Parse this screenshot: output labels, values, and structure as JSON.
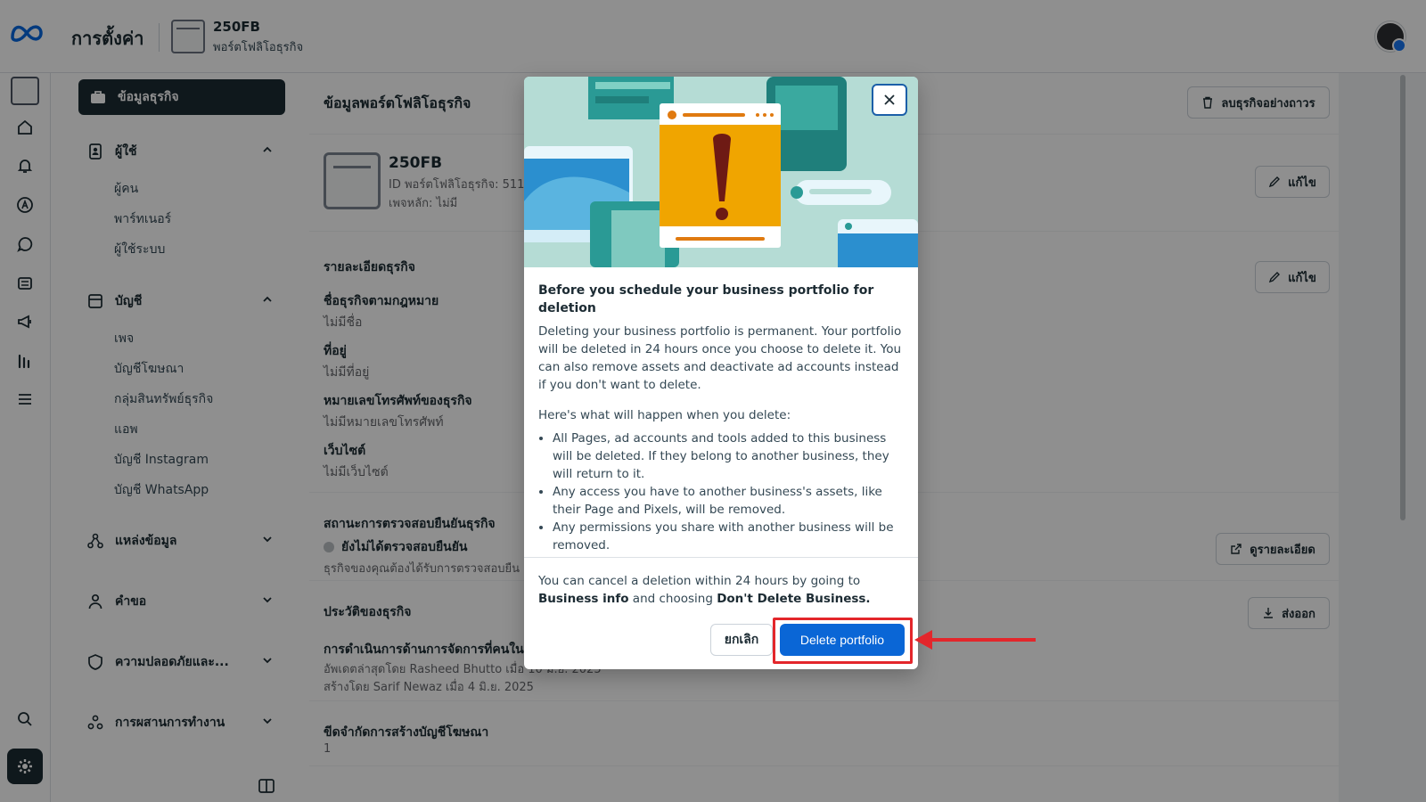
{
  "header": {
    "title": "การตั้งค่า",
    "portfolio_name": "250FB",
    "portfolio_sub": "พอร์ตโฟลิโอธุรกิจ"
  },
  "nav": {
    "active": "ข้อมูลธุรกิจ",
    "groups": [
      {
        "label": "ผู้ใช้",
        "items": [
          "ผู้คน",
          "พาร์ทเนอร์",
          "ผู้ใช้ระบบ"
        ]
      },
      {
        "label": "บัญชี",
        "items": [
          "เพจ",
          "บัญชีโฆษณา",
          "กลุ่มสินทรัพย์ธุรกิจ",
          "แอพ",
          "บัญชี Instagram",
          "บัญชี WhatsApp"
        ]
      },
      {
        "label": "แหล่งข้อมูล",
        "items": []
      },
      {
        "label": "คำขอ",
        "items": []
      },
      {
        "label": "ความปลอดภัยและ...",
        "items": []
      },
      {
        "label": "การผสานการทำงาน",
        "items": []
      }
    ]
  },
  "main": {
    "section_title": "ข้อมูลพอร์ตโฟลิโอธุรกิจ",
    "delete_permanent": "ลบธุรกิจอย่างถาวร",
    "edit_label": "แก้ไข",
    "biz_name": "250FB",
    "biz_id": "ID พอร์ตโฟลิโอธุรกิจ: 511",
    "main_page": "เพจหลัก: ไม่มี",
    "details_title": "รายละเอียดธุรกิจ",
    "legal_name_label": "ชื่อธุรกิจตามกฎหมาย",
    "legal_name_value": "ไม่มีชื่อ",
    "address_label": "ที่อยู่",
    "address_value": "ไม่มีที่อยู่",
    "phone_label": "หมายเลขโทรศัพท์ของธุรกิจ",
    "phone_value": "ไม่มีหมายเลขโทรศัพท์",
    "website_label": "เว็บไซต์",
    "website_value": "ไม่มีเว็บไซต์",
    "verify_title": "สถานะการตรวจสอบยืนยันธุรกิจ",
    "verify_status": "ยังไม่ได้ตรวจสอบยืนยัน",
    "verify_desc": "ธุรกิจของคุณต้องได้รับการตรวจสอบยืน",
    "view_details": "ดูรายละเอียด",
    "history_title": "ประวัติของธุรกิจ",
    "export_label": "ส่งออก",
    "history_item": "การดำเนินการด้านการจัดการที่คนใน",
    "history_updated": "อัพเดตล่าสุดโดย Rasheed Bhutto เมื่อ 10 มิ.ย. 2025",
    "history_created": "สร้างโดย Sarif Newaz เมื่อ 4 มิ.ย. 2025",
    "ad_limit_title": "ขีดจำกัดการสร้างบัญชีโฆษณา",
    "ad_limit_value": "1"
  },
  "modal": {
    "title": "Before you schedule your business portfolio for deletion",
    "intro": "Deleting your business portfolio is permanent. Your portfolio will be deleted in 24 hours once you choose to delete it. You can also remove assets and deactivate ad accounts instead if you don't want to delete.",
    "list_heading": "Here's what will happen when you delete:",
    "bullets": [
      "All Pages, ad accounts and tools added to this business will be deleted. If they belong to another business, they will return to it.",
      "Any access you have to another business's assets, like their Page and Pixels, will be removed.",
      "Any permissions you share with another business will be removed."
    ],
    "footer_pre": "You can cancel a deletion within 24 hours by going to ",
    "footer_bold1": "Business info",
    "footer_mid": " and choosing ",
    "footer_bold2": "Don't Delete Business.",
    "cancel": "ยกเลิก",
    "confirm": "Delete portfolio"
  },
  "colors": {
    "primary": "#0a66d6",
    "annotation": "#e3262b",
    "nav_active": "#1c2b33"
  }
}
